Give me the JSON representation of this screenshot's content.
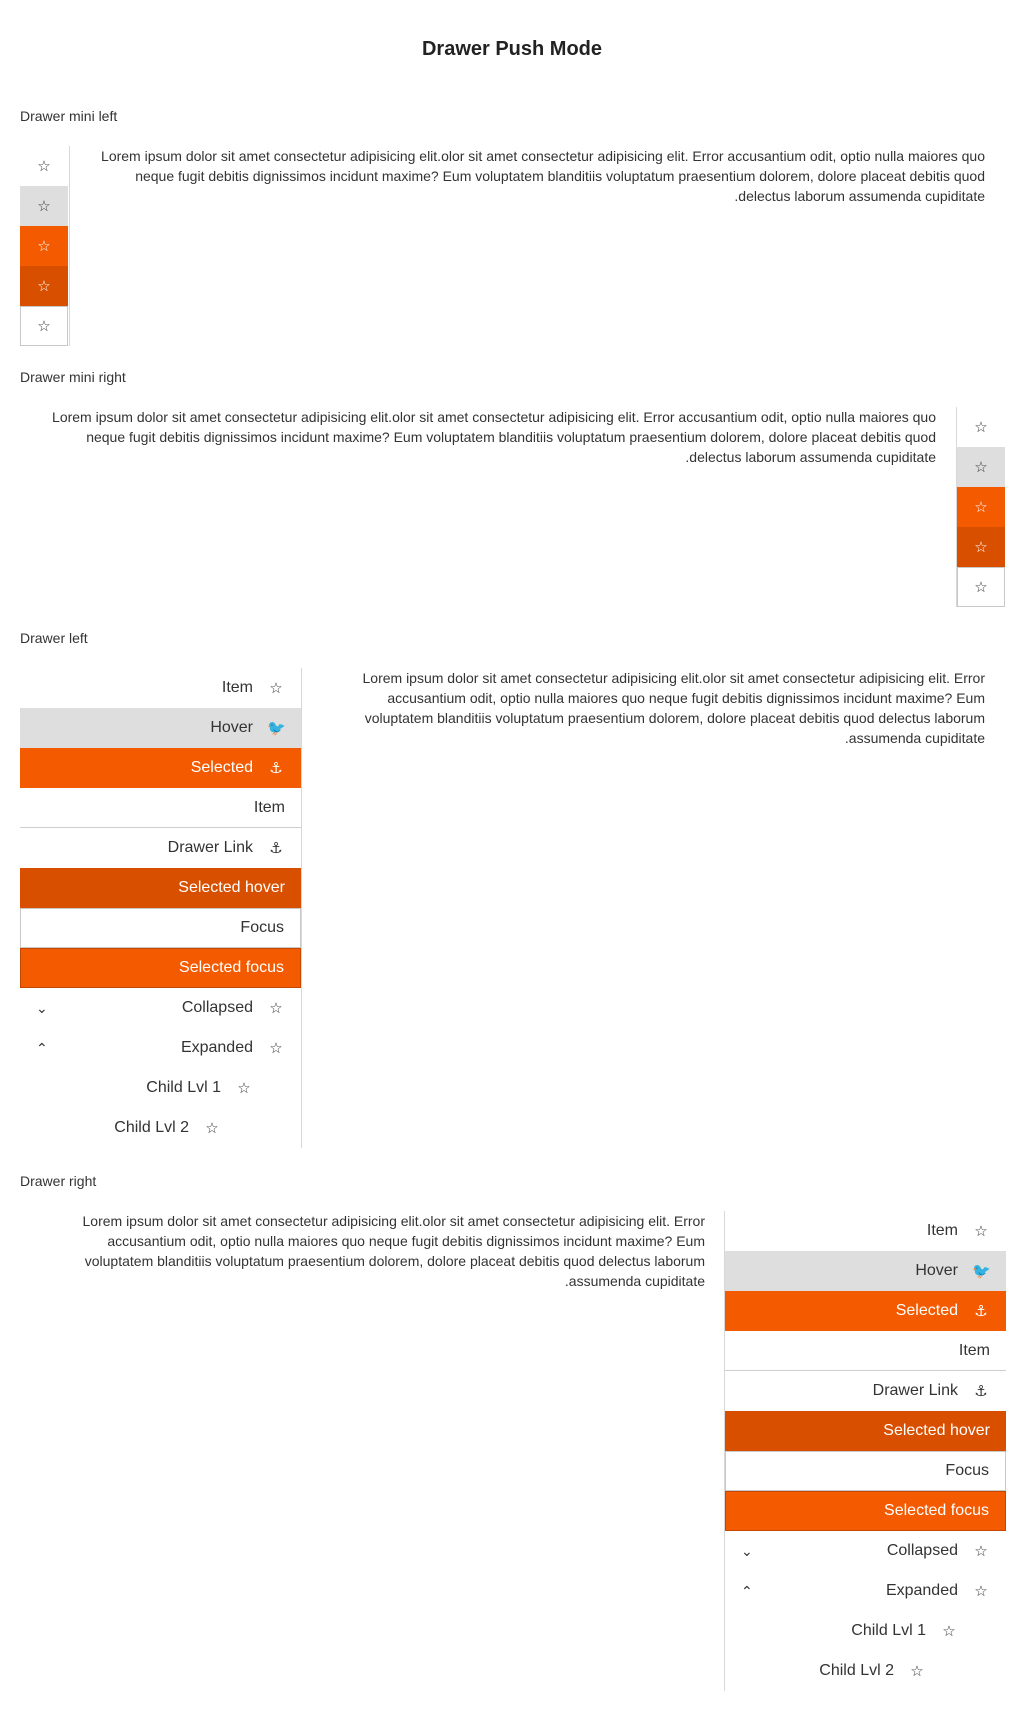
{
  "title": "Drawer Push Mode",
  "sections": {
    "mini_left": "Drawer mini left",
    "mini_right": "Drawer mini right",
    "left": "Drawer left",
    "right": "Drawer right"
  },
  "lorem": "Lorem ipsum dolor sit amet consectetur adipisicing elit.olor sit amet consectetur adipisicing elit. Error accusantium odit, optio nulla maiores quo neque fugit debitis dignissimos incidunt maxime? Eum voluptatem blanditiis voluptatum praesentium dolorem, dolore placeat debitis quod delectus laborum assumenda cupiditate.",
  "icons": {
    "star": "☆",
    "twitter": "🐦",
    "anchor": "⚓",
    "chevron_down": "⌄",
    "chevron_up": "⌃"
  },
  "mini_items": [
    "default",
    "hover",
    "selected",
    "selected-hover",
    "focus"
  ],
  "drawer_items": {
    "item": "Item",
    "hover": "Hover",
    "selected": "Selected",
    "item_plain": "Item",
    "drawer_link": "Drawer Link",
    "selected_hover": "Selected hover",
    "focus": "Focus",
    "selected_focus": "Selected focus",
    "collapsed": "Collapsed",
    "expanded": "Expanded",
    "child1": "Child Lvl 1",
    "child2": "Child Lvl 2"
  },
  "colors": {
    "selected": "#f45a00",
    "selected_hover": "#d94f00",
    "hover": "#dedede"
  }
}
